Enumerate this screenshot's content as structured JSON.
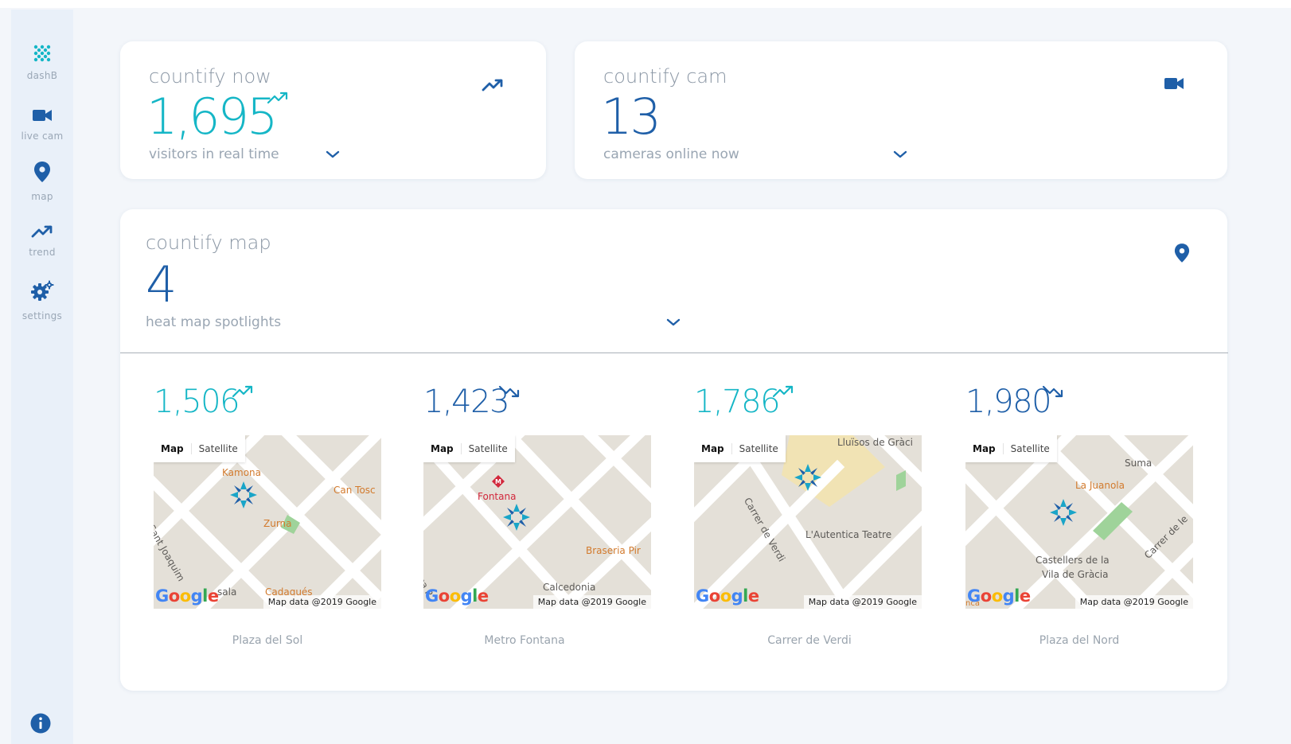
{
  "sidebar": {
    "items": [
      {
        "id": "dashboard",
        "label": "dashB",
        "icon": "dots-grid-icon"
      },
      {
        "id": "live-cam",
        "label": "live cam",
        "icon": "videocam-icon"
      },
      {
        "id": "map",
        "label": "map",
        "icon": "location-pin-icon"
      },
      {
        "id": "trend",
        "label": "trend",
        "icon": "trending-up-icon"
      },
      {
        "id": "settings",
        "label": "settings",
        "icon": "gear-icon"
      }
    ],
    "footer_icon": "info-icon"
  },
  "now_card": {
    "title": "countify now",
    "value": "1,695",
    "subtitle": "visitors in real time",
    "trend": "up",
    "icon": "trending-up-icon"
  },
  "cam_card": {
    "title": "countify cam",
    "value": "13",
    "subtitle": "cameras online now",
    "icon": "videocam-icon"
  },
  "map_card": {
    "title": "countify map",
    "value": "4",
    "subtitle": "heat map spotlights",
    "icon": "location-pin-icon",
    "map_toggle": {
      "map": "Map",
      "satellite": "Satellite"
    },
    "map_attribution": "Map data @2019 Google",
    "google_logo": "Google",
    "spotlights": [
      {
        "value": "1,506",
        "trend": "up",
        "caption": "Plaza del Sol",
        "pois": [
          "Kamona",
          "Can Tosc",
          "Zurna",
          "Sant Joaquim",
          "sala",
          "Cadaqués"
        ]
      },
      {
        "value": "1,423",
        "trend": "down",
        "caption": "Metro Fontana",
        "pois": [
          "Fontana",
          "Braseria Pir",
          "Calcedonia",
          "ca P"
        ]
      },
      {
        "value": "1,786",
        "trend": "up",
        "caption": "Carrer de Verdi",
        "pois": [
          "Lluïsos de Gràci",
          "Carrer de Verdi",
          "L'Autentica Teatre"
        ]
      },
      {
        "value": "1,980",
        "trend": "down",
        "caption": "Plaza del Nord",
        "pois": [
          "Suma",
          "La Juanola",
          "Castellers de la",
          "Vila de Gràcia",
          "Carrer de le",
          "nca"
        ]
      }
    ]
  },
  "colors": {
    "teal": "#15b6c6",
    "navy": "#1f5fa8",
    "sidebar_bg": "#e9f0f9",
    "page_bg": "#f3f6fa"
  }
}
